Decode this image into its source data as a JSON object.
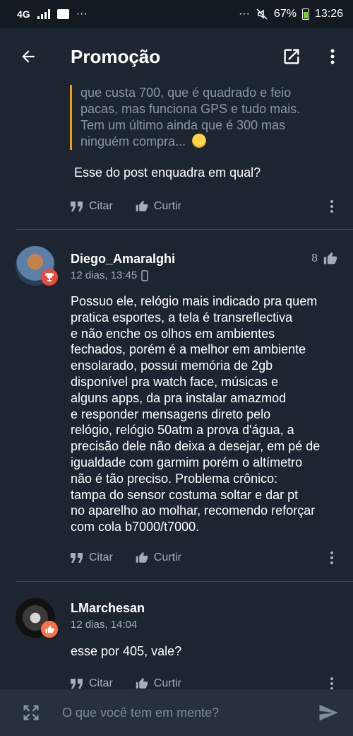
{
  "status_bar": {
    "network": "4G",
    "dots": "···",
    "right_dots": "···",
    "battery": "67%",
    "time": "13:26"
  },
  "app_bar": {
    "title": "Promoção"
  },
  "quote": {
    "text": "que custa 700, que é quadrado e feio\npacas, mas funciona GPS e tudo mais.\nTem um último ainda que é 300 mas\nninguém compra..."
  },
  "reply_text": "Esse do post enquadra em qual?",
  "actions": {
    "quote_label": "Citar",
    "like_label": "Curtir"
  },
  "posts": [
    {
      "author": "Diego_Amaralghi",
      "time": "12 dias, 13:45",
      "likes": "8",
      "lines": [
        "Possuo ele, relógio mais indicado pra quem",
        "pratica esportes, a tela é transreflectiva",
        "e não enche os olhos em ambientes",
        "fechados, porém é a melhor em ambiente",
        "ensolarado, possui memória de 2gb",
        "disponível pra watch face, músicas e",
        "alguns apps, da pra instalar amazmod",
        "e responder mensagens direto pelo",
        "relógio, relógio 50atm a prova d'água, a",
        "precisão dele não deixa a desejar, em pé de",
        "igualdade com garmim porém o altímetro",
        "não é tão preciso. Problema crônico:",
        "tampa do sensor costuma soltar e dar pt",
        "no aparelho ao molhar, recomendo reforçar",
        "com cola b7000/t7000."
      ]
    },
    {
      "author": "LMarchesan",
      "time": "12 dias, 14:04",
      "text": "esse por 405, vale?"
    }
  ],
  "composer": {
    "placeholder": "O que você tem em mente?"
  },
  "colors": {
    "background": "#1d2530",
    "quote_border": "#f39c12",
    "badge_red": "#e74c3c",
    "badge_orange": "#ff7043"
  }
}
